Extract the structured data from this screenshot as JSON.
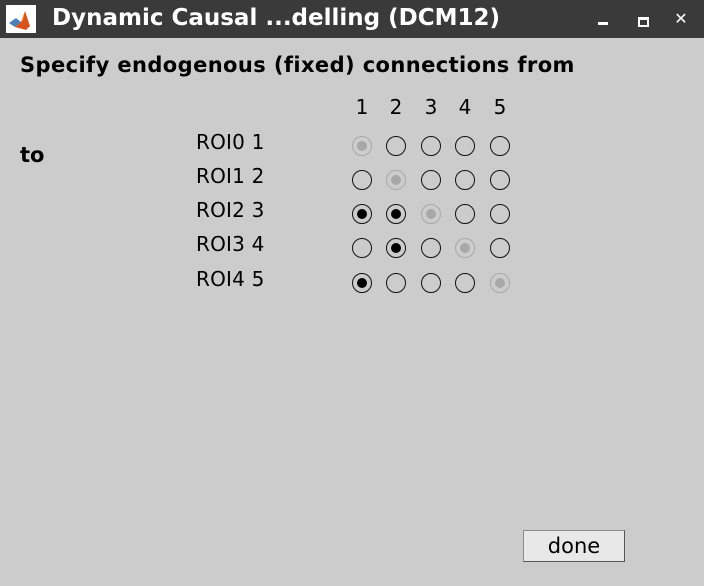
{
  "window": {
    "title": "Dynamic Causal ...delling (DCM12)"
  },
  "heading": "Specify endogenous (fixed) connections from",
  "to_label": "to",
  "columns": [
    "1",
    "2",
    "3",
    "4",
    "5"
  ],
  "rows": [
    {
      "label": "ROI0 1",
      "checked": [
        true,
        false,
        false,
        false,
        false
      ],
      "disabled_index": 0
    },
    {
      "label": "ROI1 2",
      "checked": [
        false,
        true,
        false,
        false,
        false
      ],
      "disabled_index": 1
    },
    {
      "label": "ROI2 3",
      "checked": [
        true,
        true,
        true,
        false,
        false
      ],
      "disabled_index": 2
    },
    {
      "label": "ROI3 4",
      "checked": [
        false,
        true,
        false,
        true,
        false
      ],
      "disabled_index": 3
    },
    {
      "label": "ROI4 5",
      "checked": [
        true,
        false,
        false,
        false,
        true
      ],
      "disabled_index": 4
    }
  ],
  "done_label": "done",
  "colors": {
    "titlebar": "#3a3a3a",
    "background": "#cccccc",
    "disabled": "#a8a8a8"
  }
}
